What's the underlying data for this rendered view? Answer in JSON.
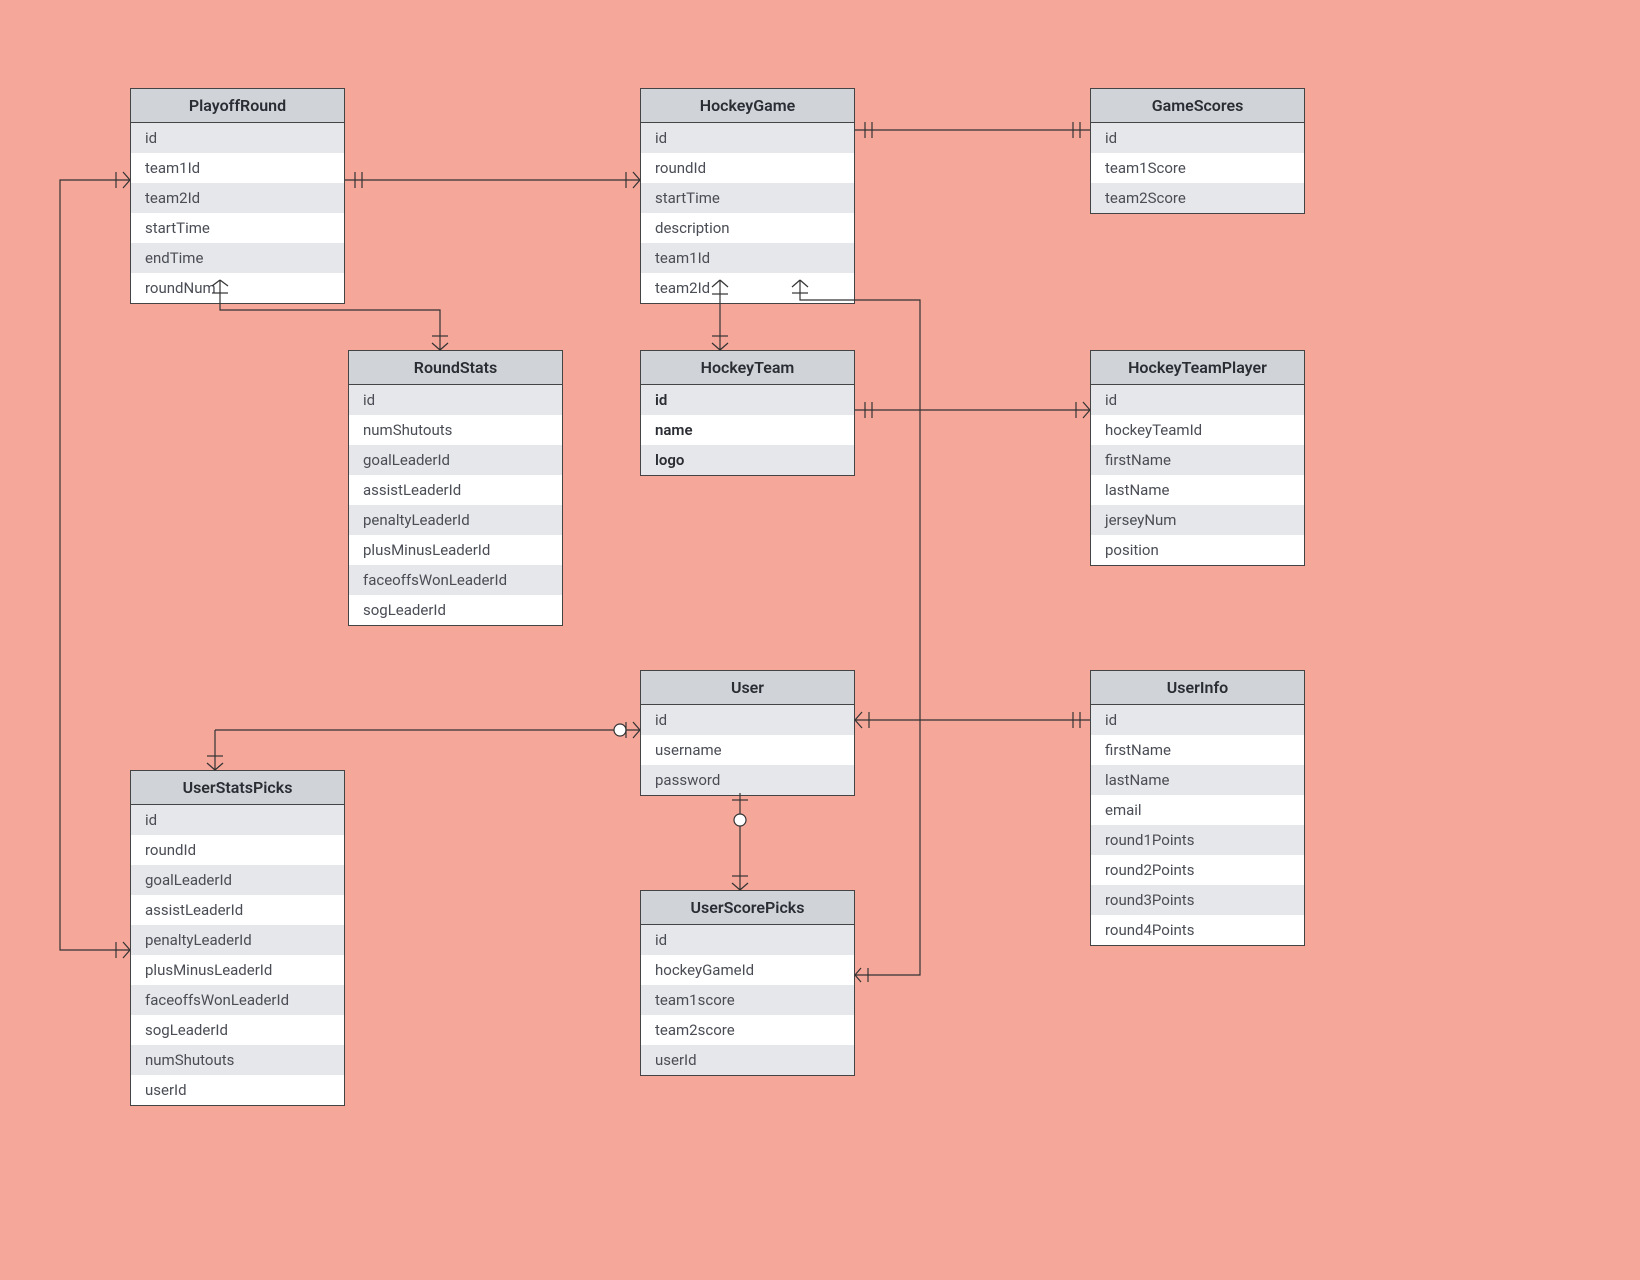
{
  "entities": {
    "playoffRound": {
      "name": "PlayoffRound",
      "fields": [
        "id",
        "team1Id",
        "team2Id",
        "startTime",
        "endTime",
        "roundNum"
      ]
    },
    "hockeyGame": {
      "name": "HockeyGame",
      "fields": [
        "id",
        "roundId",
        "startTime",
        "description",
        "team1Id",
        "team2Id"
      ]
    },
    "gameScores": {
      "name": "GameScores",
      "fields": [
        "id",
        "team1Score",
        "team2Score"
      ]
    },
    "roundStats": {
      "name": "RoundStats",
      "fields": [
        "id",
        "numShutouts",
        "goalLeaderId",
        "assistLeaderId",
        "penaltyLeaderId",
        "plusMinusLeaderId",
        "faceoffsWonLeaderId",
        "sogLeaderId"
      ]
    },
    "hockeyTeam": {
      "name": "HockeyTeam",
      "fields": [
        "id",
        "name",
        "logo"
      ],
      "bold": true
    },
    "hockeyTeamPlayer": {
      "name": "HockeyTeamPlayer",
      "fields": [
        "id",
        "hockeyTeamId",
        "firstName",
        "lastName",
        "jerseyNum",
        "position"
      ]
    },
    "user": {
      "name": "User",
      "fields": [
        "id",
        "username",
        "password"
      ]
    },
    "userInfo": {
      "name": "UserInfo",
      "fields": [
        "id",
        "firstName",
        "lastName",
        "email",
        "round1Points",
        "round2Points",
        "round3Points",
        "round4Points"
      ]
    },
    "userStatsPicks": {
      "name": "UserStatsPicks",
      "fields": [
        "id",
        "roundId",
        "goalLeaderId",
        "assistLeaderId",
        "penaltyLeaderId",
        "plusMinusLeaderId",
        "faceoffsWonLeaderId",
        "sogLeaderId",
        "numShutouts",
        "userId"
      ]
    },
    "userScorePicks": {
      "name": "UserScorePicks",
      "fields": [
        "id",
        "hockeyGameId",
        "team1score",
        "team2score",
        "userId"
      ]
    }
  }
}
